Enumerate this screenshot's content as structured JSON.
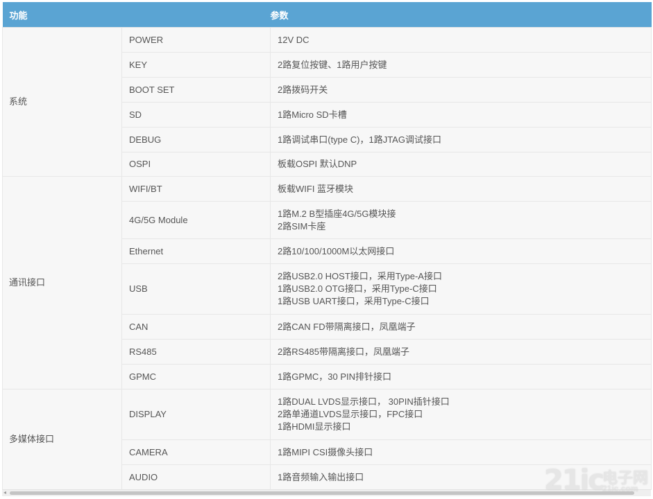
{
  "header": {
    "col_function": "功能",
    "col_params": "参数"
  },
  "groups": [
    {
      "category": "系统",
      "rows": [
        {
          "name": "POWER",
          "values": [
            "12V DC"
          ]
        },
        {
          "name": "KEY",
          "values": [
            "2路复位按键、1路用户按键"
          ]
        },
        {
          "name": "BOOT SET",
          "values": [
            "2路拨码开关"
          ]
        },
        {
          "name": "SD",
          "values": [
            "1路Micro SD卡槽"
          ]
        },
        {
          "name": "DEBUG",
          "values": [
            "1路调试串口(type C)，1路JTAG调试接口"
          ]
        },
        {
          "name": "OSPI",
          "values": [
            "板载OSPI 默认DNP"
          ]
        }
      ]
    },
    {
      "category": "通讯接口",
      "rows": [
        {
          "name": "WIFI/BT",
          "values": [
            "板载WIFI 蓝牙模块"
          ]
        },
        {
          "name": "4G/5G Module",
          "values": [
            "1路M.2 B型插座4G/5G模块接",
            "2路SIM卡座"
          ]
        },
        {
          "name": "Ethernet",
          "values": [
            "2路10/100/1000M以太网接口"
          ]
        },
        {
          "name": "USB",
          "values": [
            "2路USB2.0 HOST接口，采用Type-A接口",
            "1路USB2.0 OTG接口，采用Type-C接口",
            "1路USB UART接口，采用Type-C接口"
          ]
        },
        {
          "name": "CAN",
          "values": [
            "2路CAN FD带隔离接口，凤凰端子"
          ]
        },
        {
          "name": "RS485",
          "values": [
            "2路RS485带隔离接口，凤凰端子"
          ]
        },
        {
          "name": "GPMC",
          "values": [
            "1路GPMC，30 PIN排针接口"
          ]
        }
      ]
    },
    {
      "category": "多媒体接口",
      "rows": [
        {
          "name": "DISPLAY",
          "values": [
            "1路DUAL LVDS显示接口， 30PIN插针接口",
            "2路单通道LVDS显示接口，FPC接口",
            "1路HDMI显示接口"
          ]
        },
        {
          "name": "CAMERA",
          "values": [
            "1路MIPI CSI摄像头接口"
          ]
        },
        {
          "name": "AUDIO",
          "values": [
            "1路音频输入输出接口"
          ]
        }
      ]
    }
  ],
  "watermark": {
    "number": "21ic",
    "brand": "电子网",
    "url": "21ic.com"
  },
  "scrollbar": {
    "left_arrow": "◂"
  }
}
